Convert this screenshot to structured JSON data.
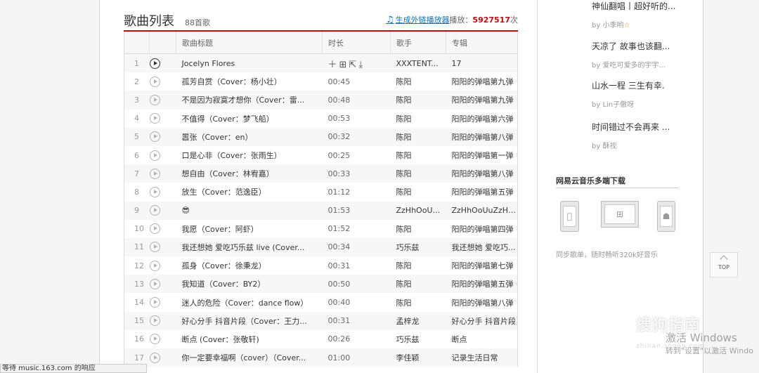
{
  "header": {
    "title": "歌曲列表",
    "count": "88首歌",
    "gen_link": "生成外链播放器",
    "plays_label": "播放：",
    "plays_count": "5927517",
    "plays_unit": "次"
  },
  "table": {
    "columns": [
      "歌曲标题",
      "时长",
      "歌手",
      "专辑"
    ],
    "rows": [
      {
        "idx": "1",
        "title": "Jocelyn Flores",
        "duration": "",
        "artist": "XXXTENT...",
        "album": "17",
        "active": true
      },
      {
        "idx": "2",
        "title": "孤芳自赏（Cover：杨小壮）",
        "duration": "00:45",
        "artist": "陈阳",
        "album": "阳阳的弹唱第九弹"
      },
      {
        "idx": "3",
        "title": "不是因为寂寞才想你（Cover：雷...",
        "duration": "00:48",
        "artist": "陈阳",
        "album": "阳阳的弹唱第九弹"
      },
      {
        "idx": "4",
        "title": "不值得（Cover：梦飞船）",
        "duration": "00:53",
        "artist": "陈阳",
        "album": "阳阳的弹唱第六弹"
      },
      {
        "idx": "5",
        "title": "嚣张（Cover：en）",
        "duration": "00:32",
        "artist": "陈阳",
        "album": "阳阳的弹唱第八弹"
      },
      {
        "idx": "6",
        "title": "口是心非（Cover：张雨生）",
        "duration": "00:25",
        "artist": "陈阳",
        "album": "阳阳的弹唱第一弹"
      },
      {
        "idx": "7",
        "title": "想自由（Cover：林宥嘉）",
        "duration": "00:33",
        "artist": "陈阳",
        "album": "阳阳的弹唱第八弹"
      },
      {
        "idx": "8",
        "title": "放生（Cover：范逸臣）",
        "duration": "01:12",
        "artist": "陈阳",
        "album": "阳阳的弹唱第五弹"
      },
      {
        "idx": "9",
        "title": "😎",
        "duration": "01:53",
        "artist": "ZzHhOoU...",
        "album": "ZzHhOoUuZzHh..."
      },
      {
        "idx": "10",
        "title": "我愿（Cover：阿虾）",
        "duration": "01:52",
        "artist": "陈阳",
        "album": "阳阳的弹唱第四弹"
      },
      {
        "idx": "11",
        "title": "我还想她 爱吃巧乐兹 live (Cover...",
        "duration": "00:34",
        "artist": "巧乐兹",
        "album": "我还想她 爱吃巧..."
      },
      {
        "idx": "12",
        "title": "孤身（Cover：徐秉龙）",
        "duration": "00:31",
        "artist": "陈阳",
        "album": "阳阳的弹唱第七弹"
      },
      {
        "idx": "13",
        "title": "我知道（Cover：BY2）",
        "duration": "00:50",
        "artist": "陈阳",
        "album": "阳阳的弹唱第五弹"
      },
      {
        "idx": "14",
        "title": "迷人的危险（Cover：dance flow）",
        "duration": "00:40",
        "artist": "陈阳",
        "album": "阳阳的弹唱第八弹"
      },
      {
        "idx": "15",
        "title": "好心分手 抖音片段（Cover：王力...",
        "duration": "00:31",
        "artist": "孟梓龙",
        "album": "好心分手 抖音片段"
      },
      {
        "idx": "16",
        "title": "断点 (Cover：张敬轩)",
        "duration": "00:26",
        "artist": "巧乐兹",
        "album": "断点"
      },
      {
        "idx": "17",
        "title": "你一定要幸福啊（cover）（Cover...",
        "duration": "01:00",
        "artist": "李佳颖",
        "album": "记录生活日常"
      }
    ]
  },
  "sidebar": {
    "playlists": [
      {
        "name": "神仙翻唱丨超好听的...",
        "by": "by 小季哟",
        "star": true
      },
      {
        "name": "天凉了 故事也该翻...",
        "by": "by 爱吃可爱多的宇宇..."
      },
      {
        "name": "山水一程 三生有幸.",
        "by": "by Lin子傲呀"
      },
      {
        "name": "时间错过不会再来 ...",
        "by": "by 酥视"
      }
    ],
    "download": {
      "title": "网易云音乐多端下载",
      "desc": "同步歌单，随时畅听320k好音乐"
    }
  },
  "top_button": "TOP",
  "status_bar": "等待 music.163.com 的响应",
  "overlay": {
    "watermark": "搜狗指南",
    "watermark_sub": "zhinan.sogou.com",
    "activate": "激活 Windows",
    "activate_sub": "转到\"设置\"以激活 Windo"
  },
  "icons": {
    "note": "music-note-icon",
    "ops": [
      "add-icon",
      "folder-add-icon",
      "share-icon",
      "download-icon"
    ],
    "devices": [
      "apple-icon",
      "windows-icon",
      "android-icon"
    ]
  },
  "colors": {
    "accent": "#c20c0c",
    "link": "#0c73c2"
  }
}
